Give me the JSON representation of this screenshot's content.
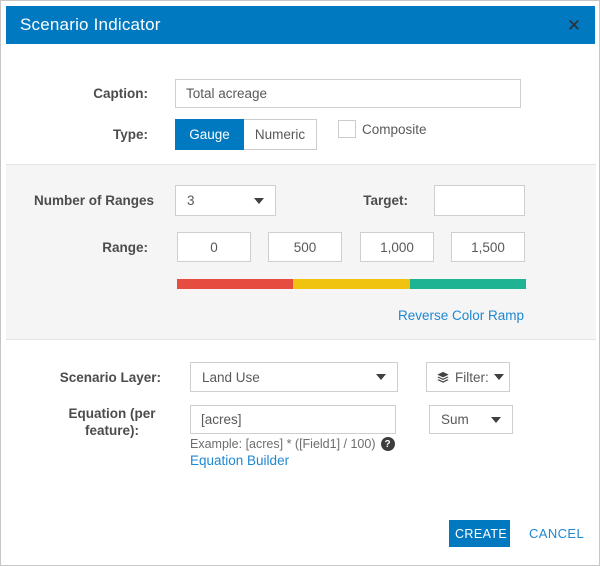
{
  "colors": {
    "accent": "#0079c1",
    "link": "#1e88d2"
  },
  "header": {
    "title": "Scenario Indicator",
    "close_glyph": "✕"
  },
  "caption": {
    "label": "Caption:",
    "value": "Total acreage"
  },
  "type": {
    "label": "Type:",
    "gauge_label": "Gauge",
    "numeric_label": "Numeric",
    "selected": "Gauge",
    "composite_label": "Composite",
    "composite_checked": false
  },
  "ranges": {
    "number_label": "Number of Ranges",
    "number_value": "3",
    "target_label": "Target:",
    "target_value": "",
    "range_label": "Range:",
    "range_values": [
      "0",
      "500",
      "1,000",
      "1,500"
    ],
    "ramp_colors": [
      "#e64c3f",
      "#efc310",
      "#1eb392"
    ],
    "reverse_link": "Reverse Color Ramp"
  },
  "layer": {
    "label": "Scenario Layer:",
    "value": "Land Use",
    "filter_label": "Filter:"
  },
  "equation": {
    "label_line1": "Equation (per",
    "label_line2": "feature):",
    "value": "[acres]",
    "aggregation": "Sum",
    "example": "Example: [acres] * ([Field1] / 100)",
    "help_glyph": "?",
    "builder_link": "Equation Builder"
  },
  "footer": {
    "create": "CREATE",
    "cancel": "CANCEL"
  }
}
